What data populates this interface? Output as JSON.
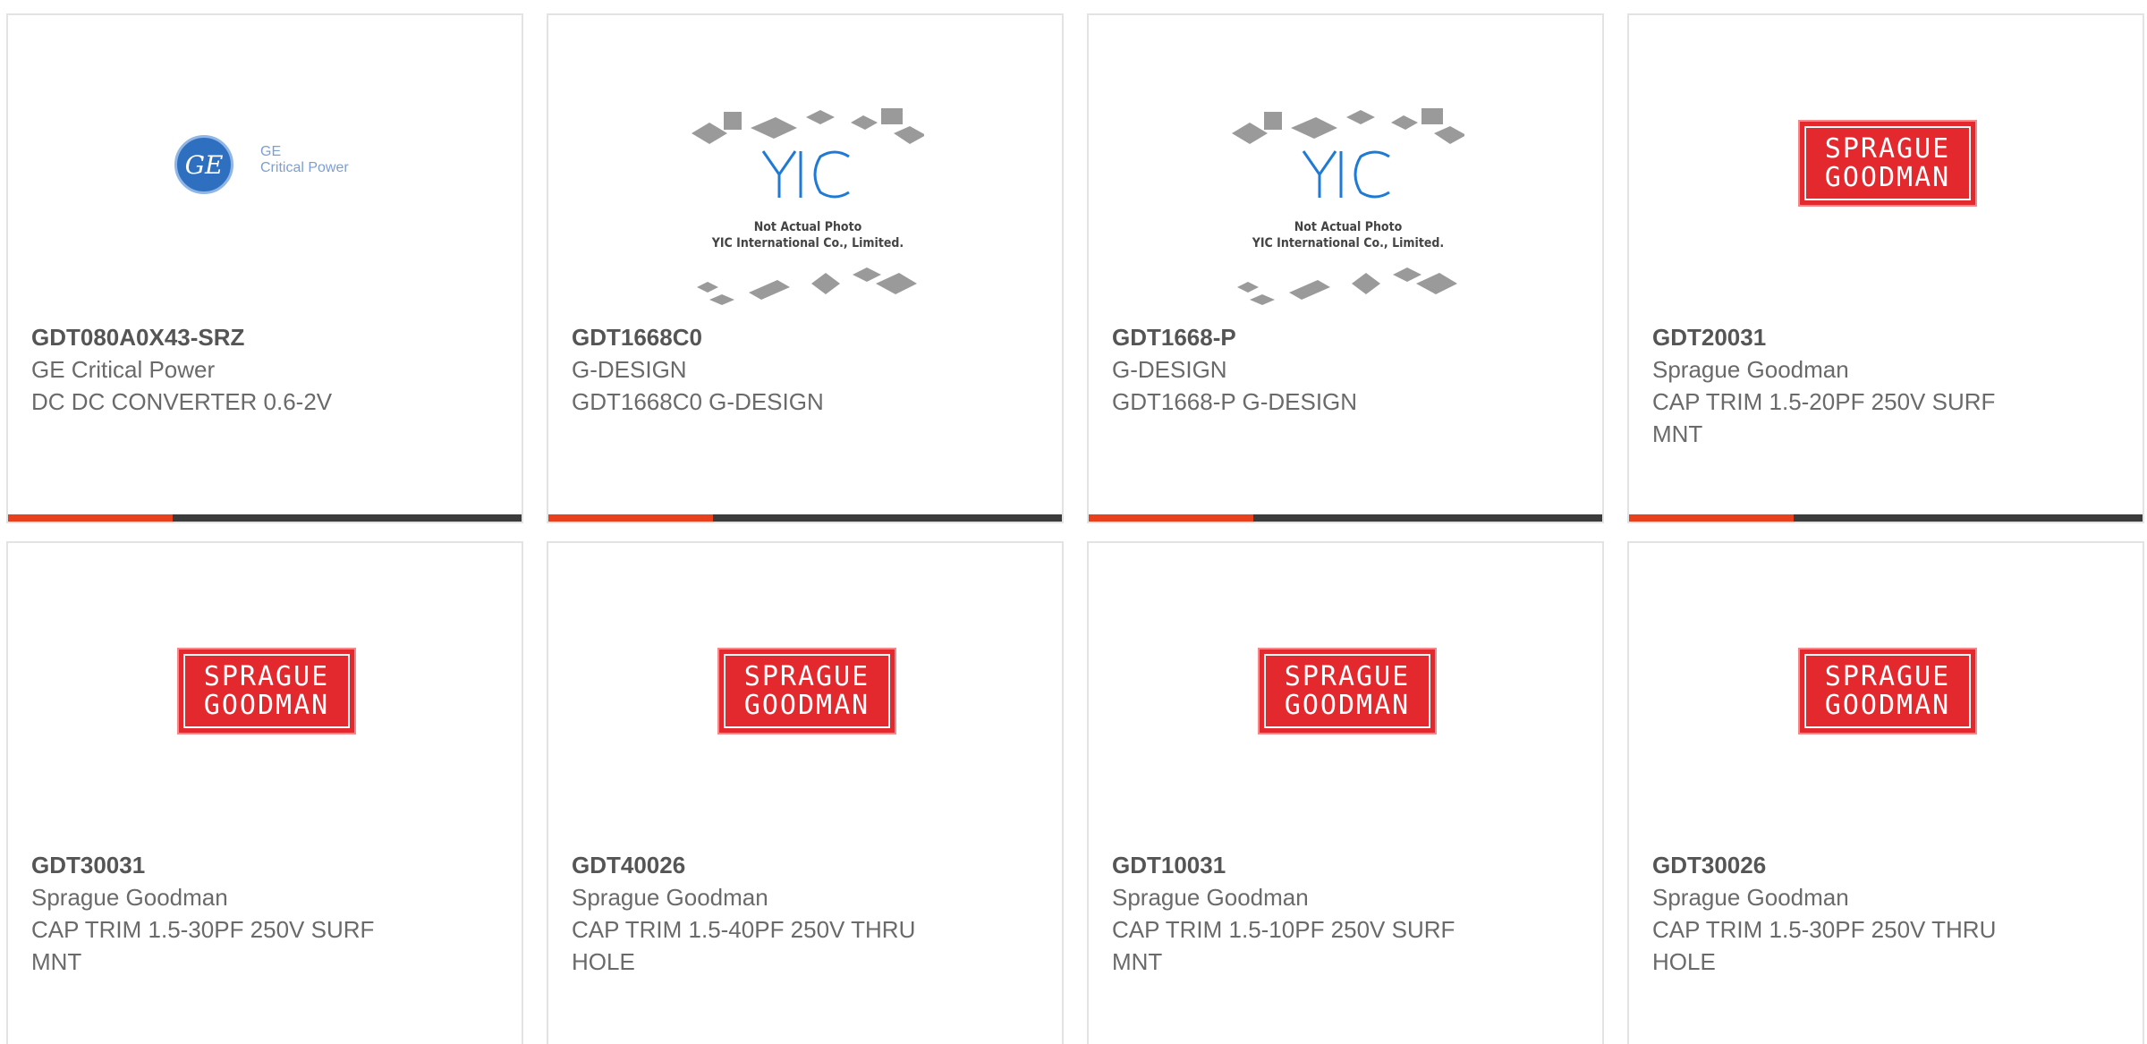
{
  "products": [
    {
      "part": "GDT080A0X43-SRZ",
      "manufacturer": "GE Critical Power",
      "description": "DC DC CONVERTER 0.6-2V",
      "logo": "ge-critical-power-logo",
      "logo_text": {
        "line1": "GE",
        "line2": "Critical Power",
        "mark": "GE"
      }
    },
    {
      "part": "GDT1668C0",
      "manufacturer": "G-DESIGN",
      "description": "GDT1668C0 G-DESIGN",
      "logo": "yic-not-actual-photo",
      "logo_text": {
        "line1": "Not Actual Photo",
        "line2": "YIC International Co., Limited."
      }
    },
    {
      "part": "GDT1668-P",
      "manufacturer": "G-DESIGN",
      "description": "GDT1668-P G-DESIGN",
      "logo": "yic-not-actual-photo",
      "logo_text": {
        "line1": "Not Actual Photo",
        "line2": "YIC International Co., Limited."
      }
    },
    {
      "part": "GDT20031",
      "manufacturer": "Sprague Goodman",
      "description": "CAP TRIM 1.5-20PF 250V SURF MNT",
      "logo": "sprague-goodman-logo",
      "logo_text": {
        "line1": "SPRAGUE",
        "line2": "GOODMAN"
      }
    },
    {
      "part": "GDT30031",
      "manufacturer": "Sprague Goodman",
      "description": "CAP TRIM 1.5-30PF 250V SURF MNT",
      "logo": "sprague-goodman-logo",
      "logo_text": {
        "line1": "SPRAGUE",
        "line2": "GOODMAN"
      }
    },
    {
      "part": "GDT40026",
      "manufacturer": "Sprague Goodman",
      "description": "CAP TRIM 1.5-40PF 250V THRU HOLE",
      "logo": "sprague-goodman-logo",
      "logo_text": {
        "line1": "SPRAGUE",
        "line2": "GOODMAN"
      }
    },
    {
      "part": "GDT10031",
      "manufacturer": "Sprague Goodman",
      "description": "CAP TRIM 1.5-10PF 250V SURF MNT",
      "logo": "sprague-goodman-logo",
      "logo_text": {
        "line1": "SPRAGUE",
        "line2": "GOODMAN"
      }
    },
    {
      "part": "GDT30026",
      "manufacturer": "Sprague Goodman",
      "description": "CAP TRIM 1.5-30PF 250V THRU HOLE",
      "logo": "sprague-goodman-logo",
      "logo_text": {
        "line1": "SPRAGUE",
        "line2": "GOODMAN"
      }
    }
  ],
  "colors": {
    "accent": "#e8401c",
    "progress_track": "#3b3b3b",
    "sprague_red": "#e3282e",
    "ge_blue": "#2f6fc0",
    "yic_blue": "#1f7ad6"
  }
}
